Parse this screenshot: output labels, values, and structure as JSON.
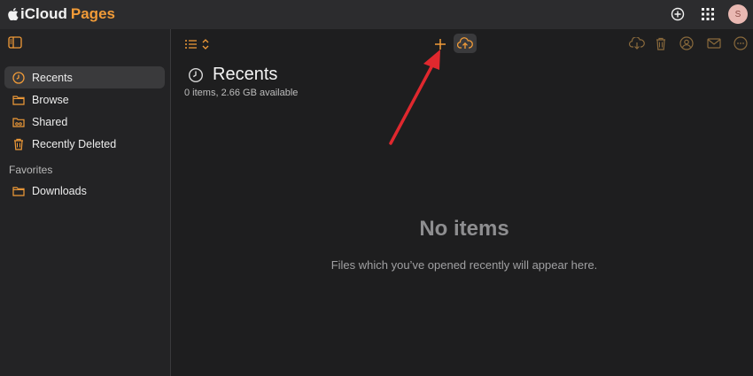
{
  "app": {
    "brand_icloud": "iCloud",
    "brand_pages": "Pages",
    "avatar_initial": "S"
  },
  "sidebar": {
    "items": [
      {
        "label": "Recents",
        "icon": "clock-icon",
        "active": true
      },
      {
        "label": "Browse",
        "icon": "folder-icon",
        "active": false
      },
      {
        "label": "Shared",
        "icon": "shared-folder-icon",
        "active": false
      },
      {
        "label": "Recently Deleted",
        "icon": "trash-icon",
        "active": false
      }
    ],
    "favorites_heading": "Favorites",
    "favorites": [
      {
        "label": "Downloads",
        "icon": "folder-icon"
      }
    ]
  },
  "main": {
    "title": "Recents",
    "subinfo": "0 items, 2.66 GB available",
    "empty_title": "No items",
    "empty_subtitle": "Files which you’ve opened recently will appear here."
  },
  "colors": {
    "accent": "#f19b38",
    "annotation_arrow": "#e0282e",
    "background": "#1e1e1f",
    "sidebar": "#232325",
    "topbar": "#2c2c2e"
  },
  "annotation": {
    "type": "red-arrow",
    "points_to": "add-button"
  }
}
